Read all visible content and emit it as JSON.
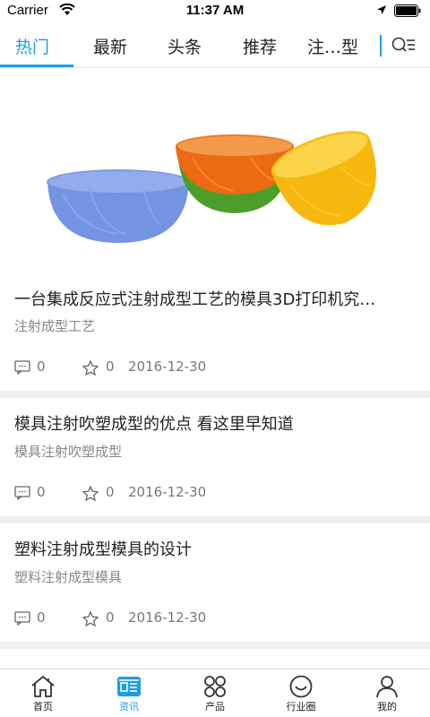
{
  "status_bar": {
    "carrier": "Carrier",
    "time": "11:37 AM"
  },
  "tabs": [
    {
      "label": "热门",
      "active": true
    },
    {
      "label": "最新",
      "active": false
    },
    {
      "label": "头条",
      "active": false
    },
    {
      "label": "推荐",
      "active": false
    },
    {
      "label": "注…型",
      "active": false
    }
  ],
  "articles": [
    {
      "title": "一台集成反应式注射成型工艺的模具3D打印机究…",
      "tag": "注射成型工艺",
      "comments": "0",
      "favorites": "0",
      "date": "2016-12-30"
    },
    {
      "title": "模具注射吹塑成型的优点 看这里早知道",
      "tag": "模具注射吹塑成型",
      "comments": "0",
      "favorites": "0",
      "date": "2016-12-30"
    },
    {
      "title": "塑料注射成型模具的设计",
      "tag": "塑料注射成型模具",
      "comments": "0",
      "favorites": "0",
      "date": "2016-12-30"
    }
  ],
  "bottom_nav": [
    {
      "label": "首页",
      "icon": "home-icon",
      "active": false
    },
    {
      "label": "资讯",
      "icon": "news-icon",
      "active": true
    },
    {
      "label": "产品",
      "icon": "grid-icon",
      "active": false
    },
    {
      "label": "行业圈",
      "icon": "smile-icon",
      "active": false
    },
    {
      "label": "我的",
      "icon": "user-icon",
      "active": false
    }
  ],
  "colors": {
    "accent": "#1a9ee6",
    "text": "#222222",
    "muted": "#888888",
    "divider": "#f0f0f0"
  }
}
